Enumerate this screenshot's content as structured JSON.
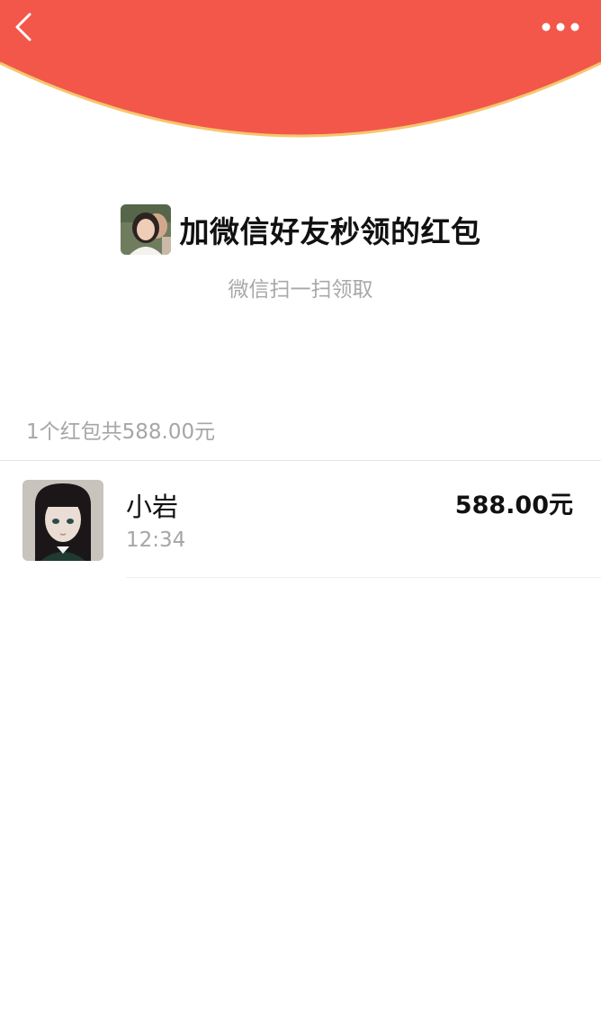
{
  "header": {
    "bg_color": "#f2574a",
    "edge_color": "#f6c66d",
    "back_icon": "chevron-left-icon",
    "more_icon": "more-dots-icon"
  },
  "packet": {
    "title": "加微信好友秒领的红包",
    "subtitle": "微信扫一扫领取",
    "summary": "1个红包共588.00元"
  },
  "records": [
    {
      "name": "小岩",
      "time": "12:34",
      "amount": "588.00元"
    }
  ]
}
